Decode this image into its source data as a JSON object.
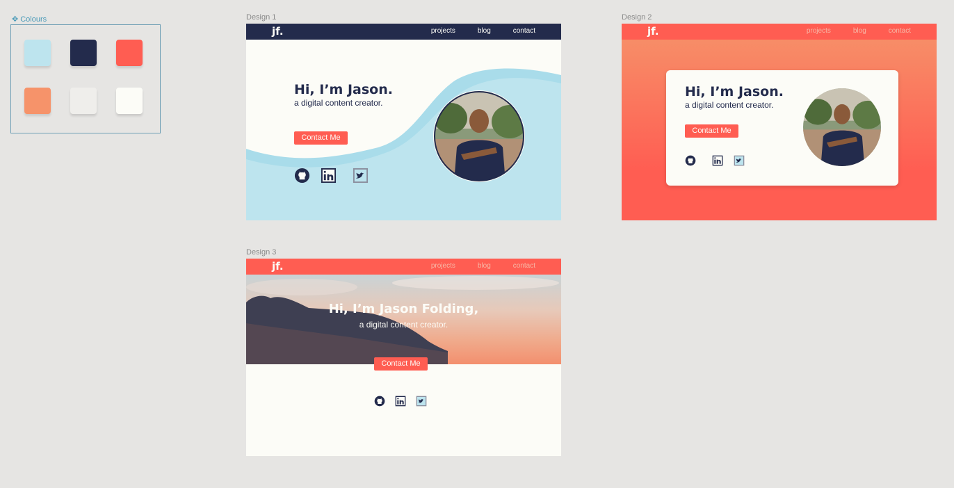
{
  "colours": {
    "label": "Colours",
    "icon": "component-icon",
    "swatches": [
      "#bde4ee",
      "#232b4c",
      "#ff5d52",
      "#f6936a",
      "#efeeeb",
      "#fcfcf7"
    ]
  },
  "design1": {
    "label": "Design 1",
    "logo": "jf.",
    "nav": [
      "projects",
      "blog",
      "contact"
    ],
    "title": "Hi, I’m Jason.",
    "subtitle": "a digital content creator.",
    "button": "Contact Me",
    "social_icons": [
      "github-icon",
      "linkedin-icon",
      "twitter-icon"
    ]
  },
  "design2": {
    "label": "Design 2",
    "logo": "jf.",
    "nav": [
      "projects",
      "blog",
      "contact"
    ],
    "title": "Hi, I’m Jason.",
    "subtitle": "a digital content creator.",
    "button": "Contact Me",
    "social_icons": [
      "github-icon",
      "linkedin-icon",
      "twitter-icon"
    ]
  },
  "design3": {
    "label": "Design 3",
    "logo": "jf.",
    "nav": [
      "projects",
      "blog",
      "contact"
    ],
    "title": "Hi, I’m Jason Folding,",
    "subtitle": "a digital content creator.",
    "button": "Contact Me",
    "social_icons": [
      "github-icon",
      "linkedin-icon",
      "twitter-icon"
    ]
  }
}
